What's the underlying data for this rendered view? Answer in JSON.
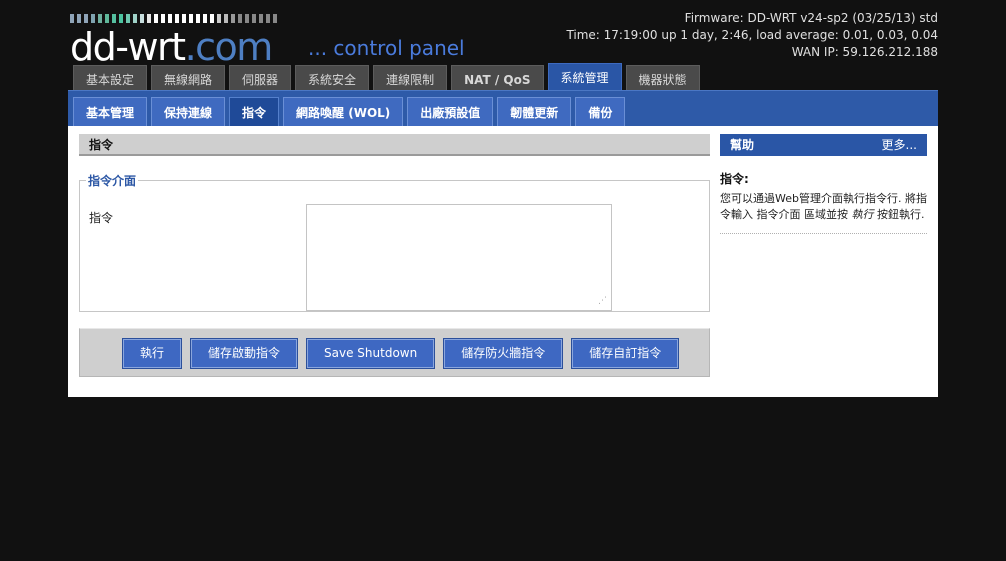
{
  "header": {
    "logo_text": "dd-wrt",
    "logo_dot": ".com",
    "logo_tagline": "... control panel",
    "firmware": "Firmware: DD-WRT v24-sp2 (03/25/13) std",
    "time": "Time: 17:19:00 up 1 day, 2:46, load average: 0.01, 0.03, 0.04",
    "wan_ip": "WAN IP: 59.126.212.188"
  },
  "main_tabs": [
    {
      "label": "基本設定"
    },
    {
      "label": "無線網路"
    },
    {
      "label": "伺服器"
    },
    {
      "label": "系統安全"
    },
    {
      "label": "連線限制"
    },
    {
      "label": "NAT / QoS"
    },
    {
      "label": "系統管理",
      "active": true
    },
    {
      "label": "機器狀態"
    }
  ],
  "sub_tabs": [
    {
      "label": "基本管理"
    },
    {
      "label": "保持連線"
    },
    {
      "label": "指令",
      "active": true
    },
    {
      "label": "網路喚醒 (WOL)"
    },
    {
      "label": "出廠預設值"
    },
    {
      "label": "韌體更新"
    },
    {
      "label": "備份"
    }
  ],
  "section": {
    "title": "指令",
    "fieldset_legend": "指令介面",
    "field_label": "指令",
    "command_value": ""
  },
  "buttons": {
    "run": "執行",
    "save_startup": "儲存啟動指令",
    "save_shutdown": "Save Shutdown",
    "save_firewall": "儲存防火牆指令",
    "save_custom": "儲存自訂指令"
  },
  "help": {
    "title": "幫助",
    "more": "更多...",
    "subtitle": "指令:",
    "body_part1": "您可以通過Web管理介面執行指令行. 將指令輸入 指令介面 區域並按 ",
    "body_em": "執行",
    "body_part2": " 按鈕執行."
  },
  "colors": {
    "page_bg": "#111111",
    "accent_blue": "#2a56a6",
    "button_blue": "#3e68c2",
    "tab_grey": "#4a4a4a",
    "section_grey": "#cfcfcf"
  }
}
